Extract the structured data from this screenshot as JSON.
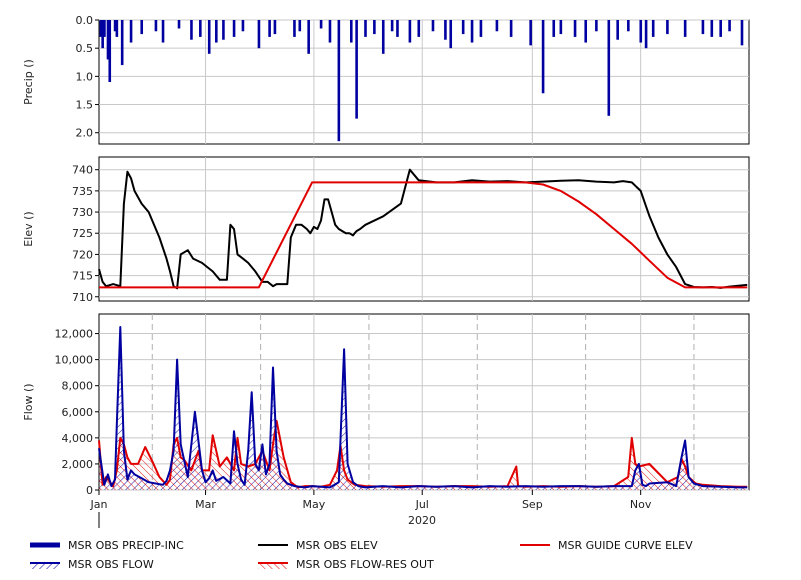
{
  "chart_data": [
    {
      "panel": "precip",
      "type": "bar",
      "ylabel": "Precip ()",
      "ylim": [
        2.2,
        0.0
      ],
      "inverted": true,
      "yticks": [
        "0.0",
        "0.5",
        "1.0",
        "1.5",
        "2.0"
      ],
      "ytick_values": [
        0,
        0.5,
        1.0,
        1.5,
        2.0
      ],
      "series": [
        {
          "name": "MSR OBS PRECIP-INC",
          "color": "#0000a0",
          "x": [
            1,
            2,
            3,
            5,
            6,
            9,
            10,
            13,
            18,
            24,
            32,
            36,
            45,
            52,
            57,
            62,
            66,
            70,
            76,
            81,
            90,
            96,
            99,
            110,
            113,
            118,
            125,
            130,
            135,
            142,
            145,
            150,
            155,
            160,
            165,
            168,
            175,
            180,
            188,
            195,
            198,
            205,
            210,
            215,
            224,
            232,
            243,
            250,
            256,
            260,
            268,
            274,
            280,
            287,
            292,
            298,
            305,
            308,
            312,
            320,
            330,
            340,
            345,
            350,
            355,
            362
          ],
          "values": [
            0.3,
            0.5,
            0.3,
            0.7,
            1.1,
            0.2,
            0.3,
            0.8,
            0.4,
            0.25,
            0.2,
            0.4,
            0.15,
            0.35,
            0.3,
            0.6,
            0.4,
            0.35,
            0.3,
            0.2,
            0.5,
            0.3,
            0.25,
            0.3,
            0.2,
            0.6,
            0.15,
            0.4,
            2.15,
            0.4,
            1.75,
            0.3,
            0.25,
            0.6,
            0.2,
            0.3,
            0.4,
            0.3,
            0.2,
            0.35,
            0.5,
            0.25,
            0.4,
            0.3,
            0.2,
            0.3,
            0.45,
            1.3,
            0.3,
            0.25,
            0.3,
            0.4,
            0.2,
            1.7,
            0.35,
            0.2,
            0.4,
            0.5,
            0.3,
            0.25,
            0.3,
            0.25,
            0.3,
            0.3,
            0.2,
            0.45
          ]
        }
      ]
    },
    {
      "panel": "elev",
      "type": "line",
      "ylabel": "Elev ()",
      "ylim": [
        709,
        743
      ],
      "yticks": [
        "710",
        "715",
        "720",
        "725",
        "730",
        "735",
        "740"
      ],
      "ytick_values": [
        710,
        715,
        720,
        725,
        730,
        735,
        740
      ],
      "series": [
        {
          "name": "MSR OBS ELEV",
          "color": "#000000",
          "x": [
            0,
            2,
            4,
            8,
            12,
            14,
            16,
            18,
            20,
            24,
            28,
            34,
            38,
            40,
            42,
            44,
            46,
            50,
            53,
            58,
            61,
            64,
            68,
            72,
            74,
            76,
            78,
            81,
            84,
            88,
            92,
            95,
            98,
            100,
            103,
            106,
            108,
            111,
            114,
            117,
            119,
            121,
            123,
            125,
            127,
            129,
            131,
            133,
            135,
            137,
            139,
            141,
            143,
            144,
            145,
            147,
            150,
            160,
            170,
            175,
            180,
            190,
            200,
            210,
            220,
            230,
            240,
            250,
            260,
            270,
            280,
            290,
            295,
            300,
            305,
            310,
            315,
            320,
            325,
            330,
            335,
            340,
            345,
            350,
            355,
            360,
            365
          ],
          "values": [
            716.5,
            713.5,
            712.5,
            713,
            712.5,
            732,
            739.5,
            738,
            735,
            732,
            730,
            724,
            719,
            716,
            712.5,
            712,
            720,
            721,
            719,
            718,
            717,
            716,
            714,
            714,
            727,
            726,
            720,
            719,
            718,
            716,
            713.5,
            713.5,
            712.5,
            713,
            713,
            713,
            724,
            727,
            727,
            726,
            725,
            726.5,
            726,
            728,
            733,
            733,
            730,
            727,
            726,
            725.5,
            725,
            725,
            724.5,
            725,
            725.5,
            726,
            727,
            729,
            732,
            740,
            737.5,
            737,
            737,
            737.5,
            737.2,
            737.3,
            737,
            737.2,
            737.4,
            737.5,
            737.2,
            737,
            737.3,
            737,
            735,
            729,
            724,
            720,
            717,
            713,
            712.3,
            712.2,
            712.3,
            712.1,
            712.4,
            712.6,
            712.8
          ]
        },
        {
          "name": "MSR GUIDE CURVE ELEV",
          "color": "#e00000",
          "x": [
            0,
            90,
            120,
            240,
            250,
            260,
            270,
            280,
            290,
            300,
            310,
            320,
            330,
            335,
            365
          ],
          "values": [
            712.2,
            712.2,
            737,
            737,
            736.5,
            735,
            732.5,
            729.5,
            726,
            722.5,
            718.5,
            714.5,
            712.2,
            712.2,
            712.2
          ]
        }
      ]
    },
    {
      "panel": "flow",
      "type": "area",
      "ylabel": "Flow ()",
      "ylim": [
        0,
        13500
      ],
      "yticks": [
        "0",
        "2,000",
        "4,000",
        "6,000",
        "8,000",
        "10,000",
        "12,000"
      ],
      "ytick_values": [
        0,
        2000,
        4000,
        6000,
        8000,
        10000,
        12000
      ],
      "xlabel": "2020",
      "xticks": [
        "Jan",
        "Mar",
        "May",
        "Jul",
        "Sep",
        "Nov"
      ],
      "xtick_days": [
        0,
        60,
        121,
        182,
        244,
        305
      ],
      "series": [
        {
          "name": "MSR OBS FLOW",
          "color": "#0000a0",
          "x": [
            0,
            3,
            5,
            7,
            9,
            10,
            12,
            14,
            16,
            18,
            20,
            24,
            28,
            32,
            36,
            38,
            40,
            42,
            44,
            46,
            50,
            54,
            58,
            60,
            62,
            64,
            66,
            70,
            74,
            76,
            78,
            80,
            82,
            84,
            86,
            88,
            90,
            92,
            94,
            96,
            98,
            100,
            102,
            104,
            106,
            110,
            116,
            120,
            130,
            135,
            138,
            140,
            143,
            146,
            150,
            160,
            170,
            180,
            190,
            200,
            210,
            220,
            230,
            240,
            250,
            260,
            270,
            280,
            290,
            300,
            302,
            304,
            306,
            308,
            310,
            320,
            325,
            328,
            330,
            332,
            335,
            340,
            350,
            360,
            365
          ],
          "values": [
            3200,
            400,
            1200,
            300,
            800,
            5000,
            12500,
            3000,
            800,
            1500,
            1200,
            900,
            600,
            500,
            400,
            700,
            1500,
            3000,
            10000,
            3500,
            1000,
            6000,
            1500,
            600,
            900,
            1500,
            700,
            1000,
            500,
            4500,
            2000,
            800,
            400,
            3000,
            7500,
            2000,
            1500,
            3500,
            1200,
            2000,
            9400,
            3000,
            1200,
            800,
            500,
            300,
            200,
            300,
            200,
            600,
            10800,
            2000,
            600,
            300,
            200,
            300,
            200,
            300,
            250,
            300,
            200,
            300,
            250,
            300,
            250,
            300,
            300,
            250,
            300,
            300,
            1500,
            2000,
            400,
            300,
            500,
            600,
            300,
            2500,
            3800,
            1000,
            500,
            300,
            250,
            200,
            200
          ]
        },
        {
          "name": "MSR OBS FLOW-RES OUT",
          "color": "#e00000",
          "x": [
            0,
            2,
            4,
            8,
            10,
            12,
            14,
            16,
            18,
            22,
            26,
            30,
            34,
            38,
            40,
            42,
            44,
            46,
            48,
            52,
            56,
            58,
            62,
            64,
            68,
            72,
            76,
            78,
            80,
            84,
            88,
            92,
            96,
            98,
            100,
            104,
            108,
            112,
            116,
            120,
            125,
            130,
            134,
            136,
            138,
            140,
            144,
            150,
            160,
            170,
            180,
            190,
            200,
            210,
            220,
            230,
            235,
            236,
            240,
            250,
            260,
            270,
            280,
            290,
            298,
            300,
            302,
            304,
            310,
            320,
            326,
            328,
            330,
            332,
            336,
            340,
            350,
            360,
            365
          ],
          "values": [
            3800,
            400,
            1000,
            300,
            1500,
            4000,
            3500,
            2500,
            2000,
            2000,
            3300,
            2200,
            1000,
            400,
            800,
            3500,
            4000,
            2500,
            2300,
            1500,
            3000,
            1500,
            1500,
            4200,
            1800,
            2500,
            1500,
            4000,
            2000,
            1800,
            2000,
            3000,
            1500,
            3500,
            5300,
            2500,
            600,
            200,
            300,
            300,
            250,
            400,
            1500,
            3400,
            1500,
            800,
            400,
            300,
            250,
            300,
            300,
            250,
            300,
            300,
            250,
            300,
            1800,
            300,
            250,
            300,
            250,
            300,
            250,
            300,
            1000,
            4000,
            2000,
            1800,
            2000,
            600,
            1000,
            2400,
            1800,
            1000,
            500,
            400,
            300,
            250,
            250
          ]
        }
      ]
    }
  ],
  "legend": [
    {
      "label": "MSR OBS PRECIP-INC",
      "color": "#0000a0",
      "style": "thick"
    },
    {
      "label": "MSR OBS ELEV",
      "color": "#000000",
      "style": "line"
    },
    {
      "label": "MSR GUIDE CURVE ELEV",
      "color": "#e00000",
      "style": "line"
    },
    {
      "label": "MSR OBS FLOW",
      "color": "#0000a0",
      "style": "hatch"
    },
    {
      "label": "MSR OBS FLOW-RES OUT",
      "color": "#e00000",
      "style": "hatch"
    }
  ]
}
